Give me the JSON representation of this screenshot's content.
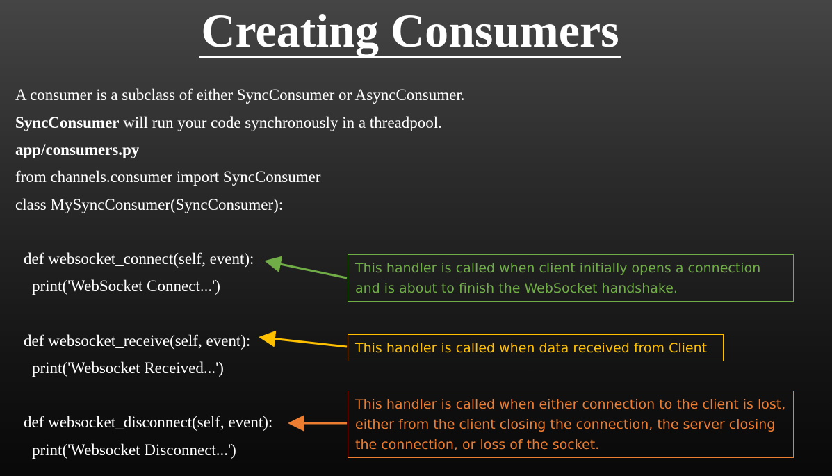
{
  "slide": {
    "title": "Creating Consumers",
    "intro": "A consumer is a subclass of either SyncConsumer or AsyncConsumer.",
    "sync_bold": "SyncConsumer",
    "sync_rest": " will run your code synchronously in a threadpool.",
    "file_path": "app/consumers.py",
    "code": {
      "import_line": "from channels.consumer import SyncConsumer",
      "class_line": "class MySyncConsumer(SyncConsumer):",
      "connect_def": "def websocket_connect(self, event):",
      "connect_print": "print('WebSocket Connect...')",
      "receive_def": "def websocket_receive(self, event):",
      "receive_print": "print('Websocket Received...')",
      "disconnect_def": "def websocket_disconnect(self, event):",
      "disconnect_print": "print('Websocket Disconnect...')"
    },
    "notes": {
      "connect": "This handler is called when client initially opens a connection and is about to finish the WebSocket handshake.",
      "receive": "This handler is called when data received from Client",
      "disconnect": "This handler is called when either connection to the client is lost, either from the client closing the connection, the server closing the connection, or loss of the socket."
    },
    "colors": {
      "connect": "#70ad47",
      "receive": "#ffc000",
      "disconnect": "#ed7d31"
    }
  }
}
